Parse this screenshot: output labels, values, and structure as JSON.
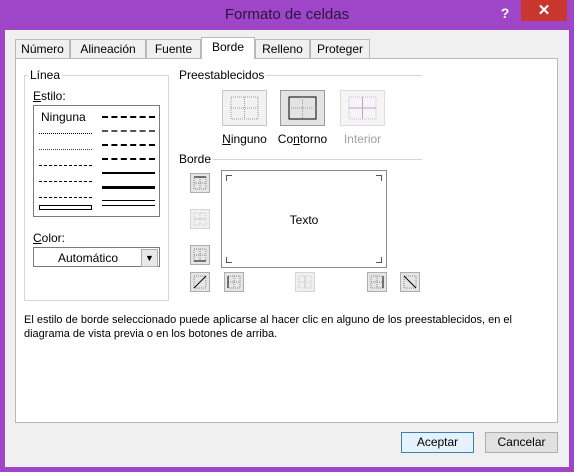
{
  "window": {
    "title": "Formato de celdas",
    "help_label": "?",
    "close_label": "✕"
  },
  "tabs": [
    {
      "label": "Número"
    },
    {
      "label": "Alineación"
    },
    {
      "label": "Fuente"
    },
    {
      "label": "Borde",
      "active": true
    },
    {
      "label": "Relleno"
    },
    {
      "label": "Proteger"
    }
  ],
  "linea": {
    "group_label": "Línea",
    "style_label_prefix": "E",
    "style_label_rest": "stilo:",
    "none_label": "Ninguna",
    "color_label_prefix": "C",
    "color_label_rest": "olor:",
    "color_value": "Automático"
  },
  "presets": {
    "label": "Preestablecidos",
    "items": [
      {
        "prefix": "N",
        "rest": "inguno",
        "enabled": true
      },
      {
        "prefix": "Co",
        "accel": "n",
        "rest": "torno",
        "enabled": true
      },
      {
        "prefix": "",
        "rest": "Interior",
        "enabled": false
      }
    ]
  },
  "border": {
    "label": "Borde",
    "preview_text": "Texto"
  },
  "description": "El estilo de borde seleccionado puede aplicarse al hacer clic en alguno de los preestablecidos, en el diagrama de vista previa o en los botones de arriba.",
  "buttons": {
    "accept": "Aceptar",
    "cancel": "Cancelar"
  },
  "colors": {
    "titlebar": "#9e45c8",
    "close": "#c7372d",
    "accent_border": "#3c7fb1"
  }
}
